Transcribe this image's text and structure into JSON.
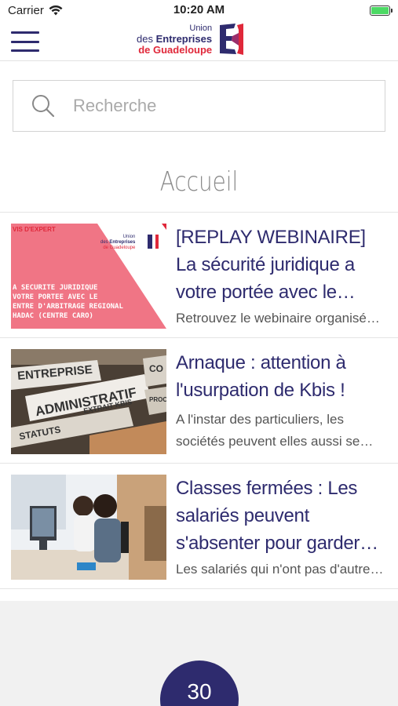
{
  "status_bar": {
    "carrier": "Carrier",
    "time": "10:20 AM",
    "battery_level": 1.0
  },
  "header": {
    "logo": {
      "line1": "Union",
      "line2_prefix": "des ",
      "line2_bold": "Entreprises",
      "line3": "de Guadeloupe"
    }
  },
  "search": {
    "placeholder": "Recherche"
  },
  "page": {
    "title": "Accueil"
  },
  "articles": [
    {
      "title": "[REPLAY WEBINAIRE] La sécurité juridique a votre portée avec le Centre d'A...",
      "excerpt": "Retrouvez le webinaire organisé p...",
      "thumb": {
        "tag": "VIS D'EXPERT",
        "text_lines": [
          "A SECURITE JURIDIQUE",
          "VOTRE PORTEE AVEC LE",
          "ENTRE D'ARBITRAGE REGIONAL",
          "HADAC (CENTRE CARO)"
        ]
      }
    },
    {
      "title": "Arnaque : attention à l'usurpation de Kbis !",
      "excerpt": "A l'instar des particuliers, les sociétés peuvent elles aussi se fai...",
      "thumb": {
        "labels": [
          "ENTREPRISE",
          "ADMINISTRATIF",
          "EXTRAIT KBIS",
          "STATUTS",
          "CO",
          "PROCÉ"
        ]
      }
    },
    {
      "title": "Classes fermées : Les salariés peuvent s'absenter pour garder le...",
      "excerpt": "Les salariés qui n'ont pas d'autre c..."
    }
  ],
  "bottom": {
    "badge_count": "30"
  },
  "colors": {
    "brand_navy": "#2e2b6e",
    "brand_red": "#e0283a",
    "thumb_pink": "#f07585"
  }
}
